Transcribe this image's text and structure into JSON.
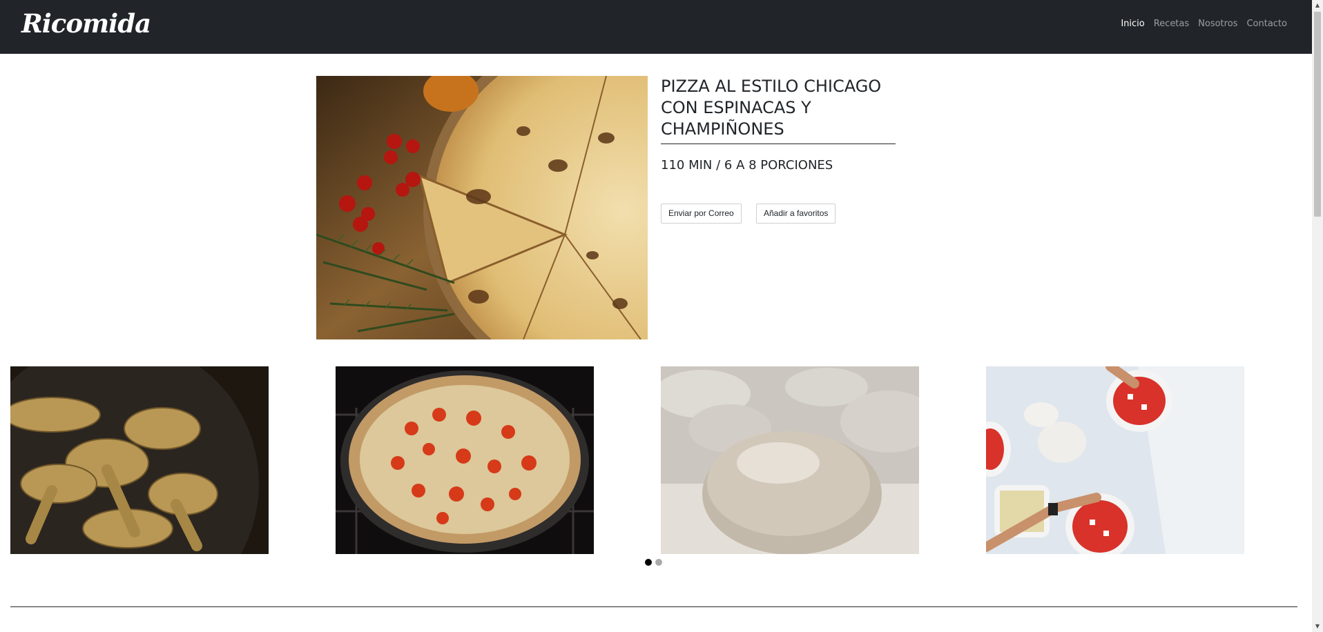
{
  "navbar": {
    "brand": "Ricomida",
    "links": [
      {
        "label": "Inicio",
        "active": true
      },
      {
        "label": "Recetas",
        "active": false
      },
      {
        "label": "Nosotros",
        "active": false
      },
      {
        "label": "Contacto",
        "active": false
      }
    ]
  },
  "recipe": {
    "title": "PIZZA AL ESTILO CHICAGO CON ESPINACAS Y CHAMPIÑONES",
    "meta": "110 MIN / 6 A 8 PORCIONES",
    "email_button": "Enviar por Correo",
    "favorites_button": "Añadir a favoritos"
  },
  "gallery": {
    "items": [
      {
        "subject": "chanterelle mushrooms in bowl"
      },
      {
        "subject": "pizza with tomatoes in oven"
      },
      {
        "subject": "dough ball with flour"
      },
      {
        "subject": "hands preparing pizzas"
      }
    ],
    "pages": 2,
    "active_page": 1
  },
  "colors": {
    "navbar_bg": "#212529",
    "nav_active": "#ffffff",
    "nav_inactive": "rgba(255,255,255,0.55)",
    "text": "#212529"
  }
}
